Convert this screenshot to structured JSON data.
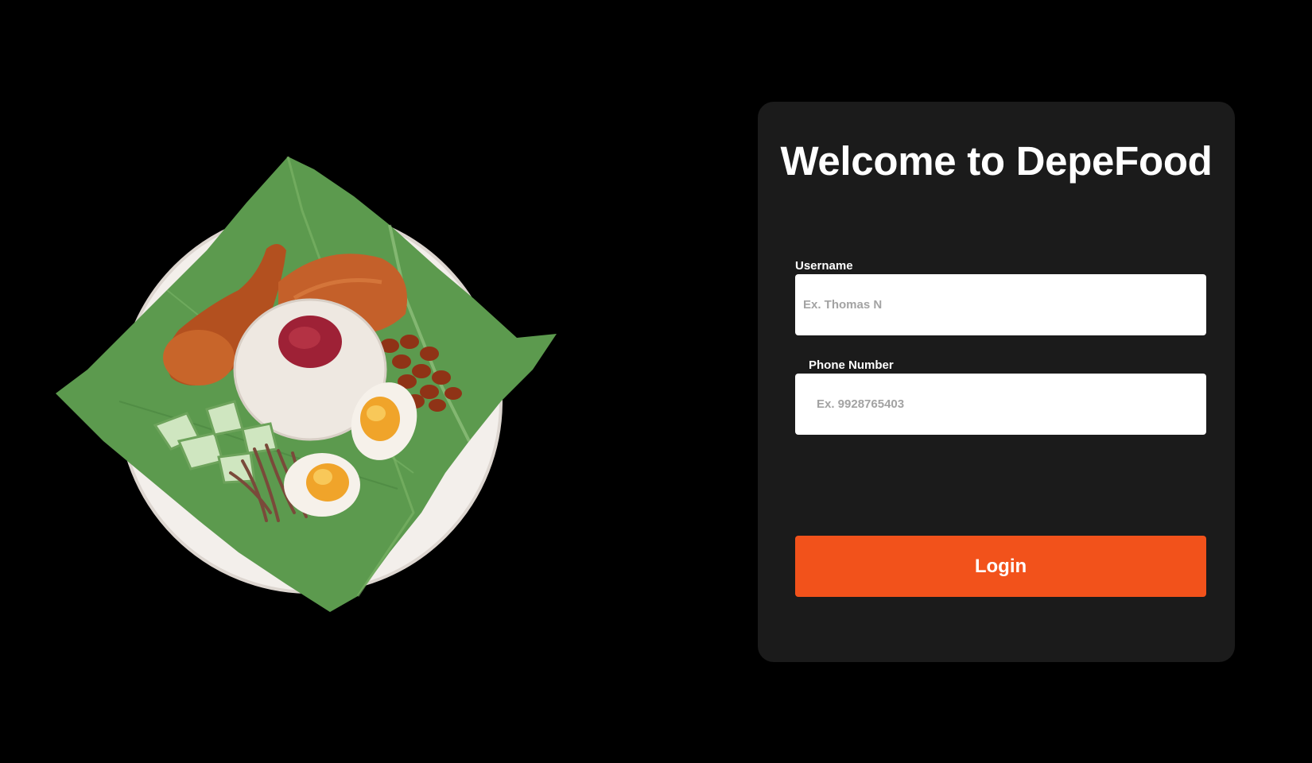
{
  "illustration": {
    "name": "nasi-lemak-illustration"
  },
  "login_card": {
    "title": "Welcome to DepeFood",
    "username": {
      "label": "Username",
      "value": "",
      "placeholder": "Ex. Thomas N"
    },
    "phone": {
      "label": "Phone Number",
      "value": "",
      "placeholder": "Ex. 9928765403"
    },
    "login_label": "Login"
  },
  "colors": {
    "page_background": "#000000",
    "card_background": "#1b1b1b",
    "accent": "#f2521b",
    "input_background": "#ffffff",
    "placeholder": "#a3a3a3"
  }
}
